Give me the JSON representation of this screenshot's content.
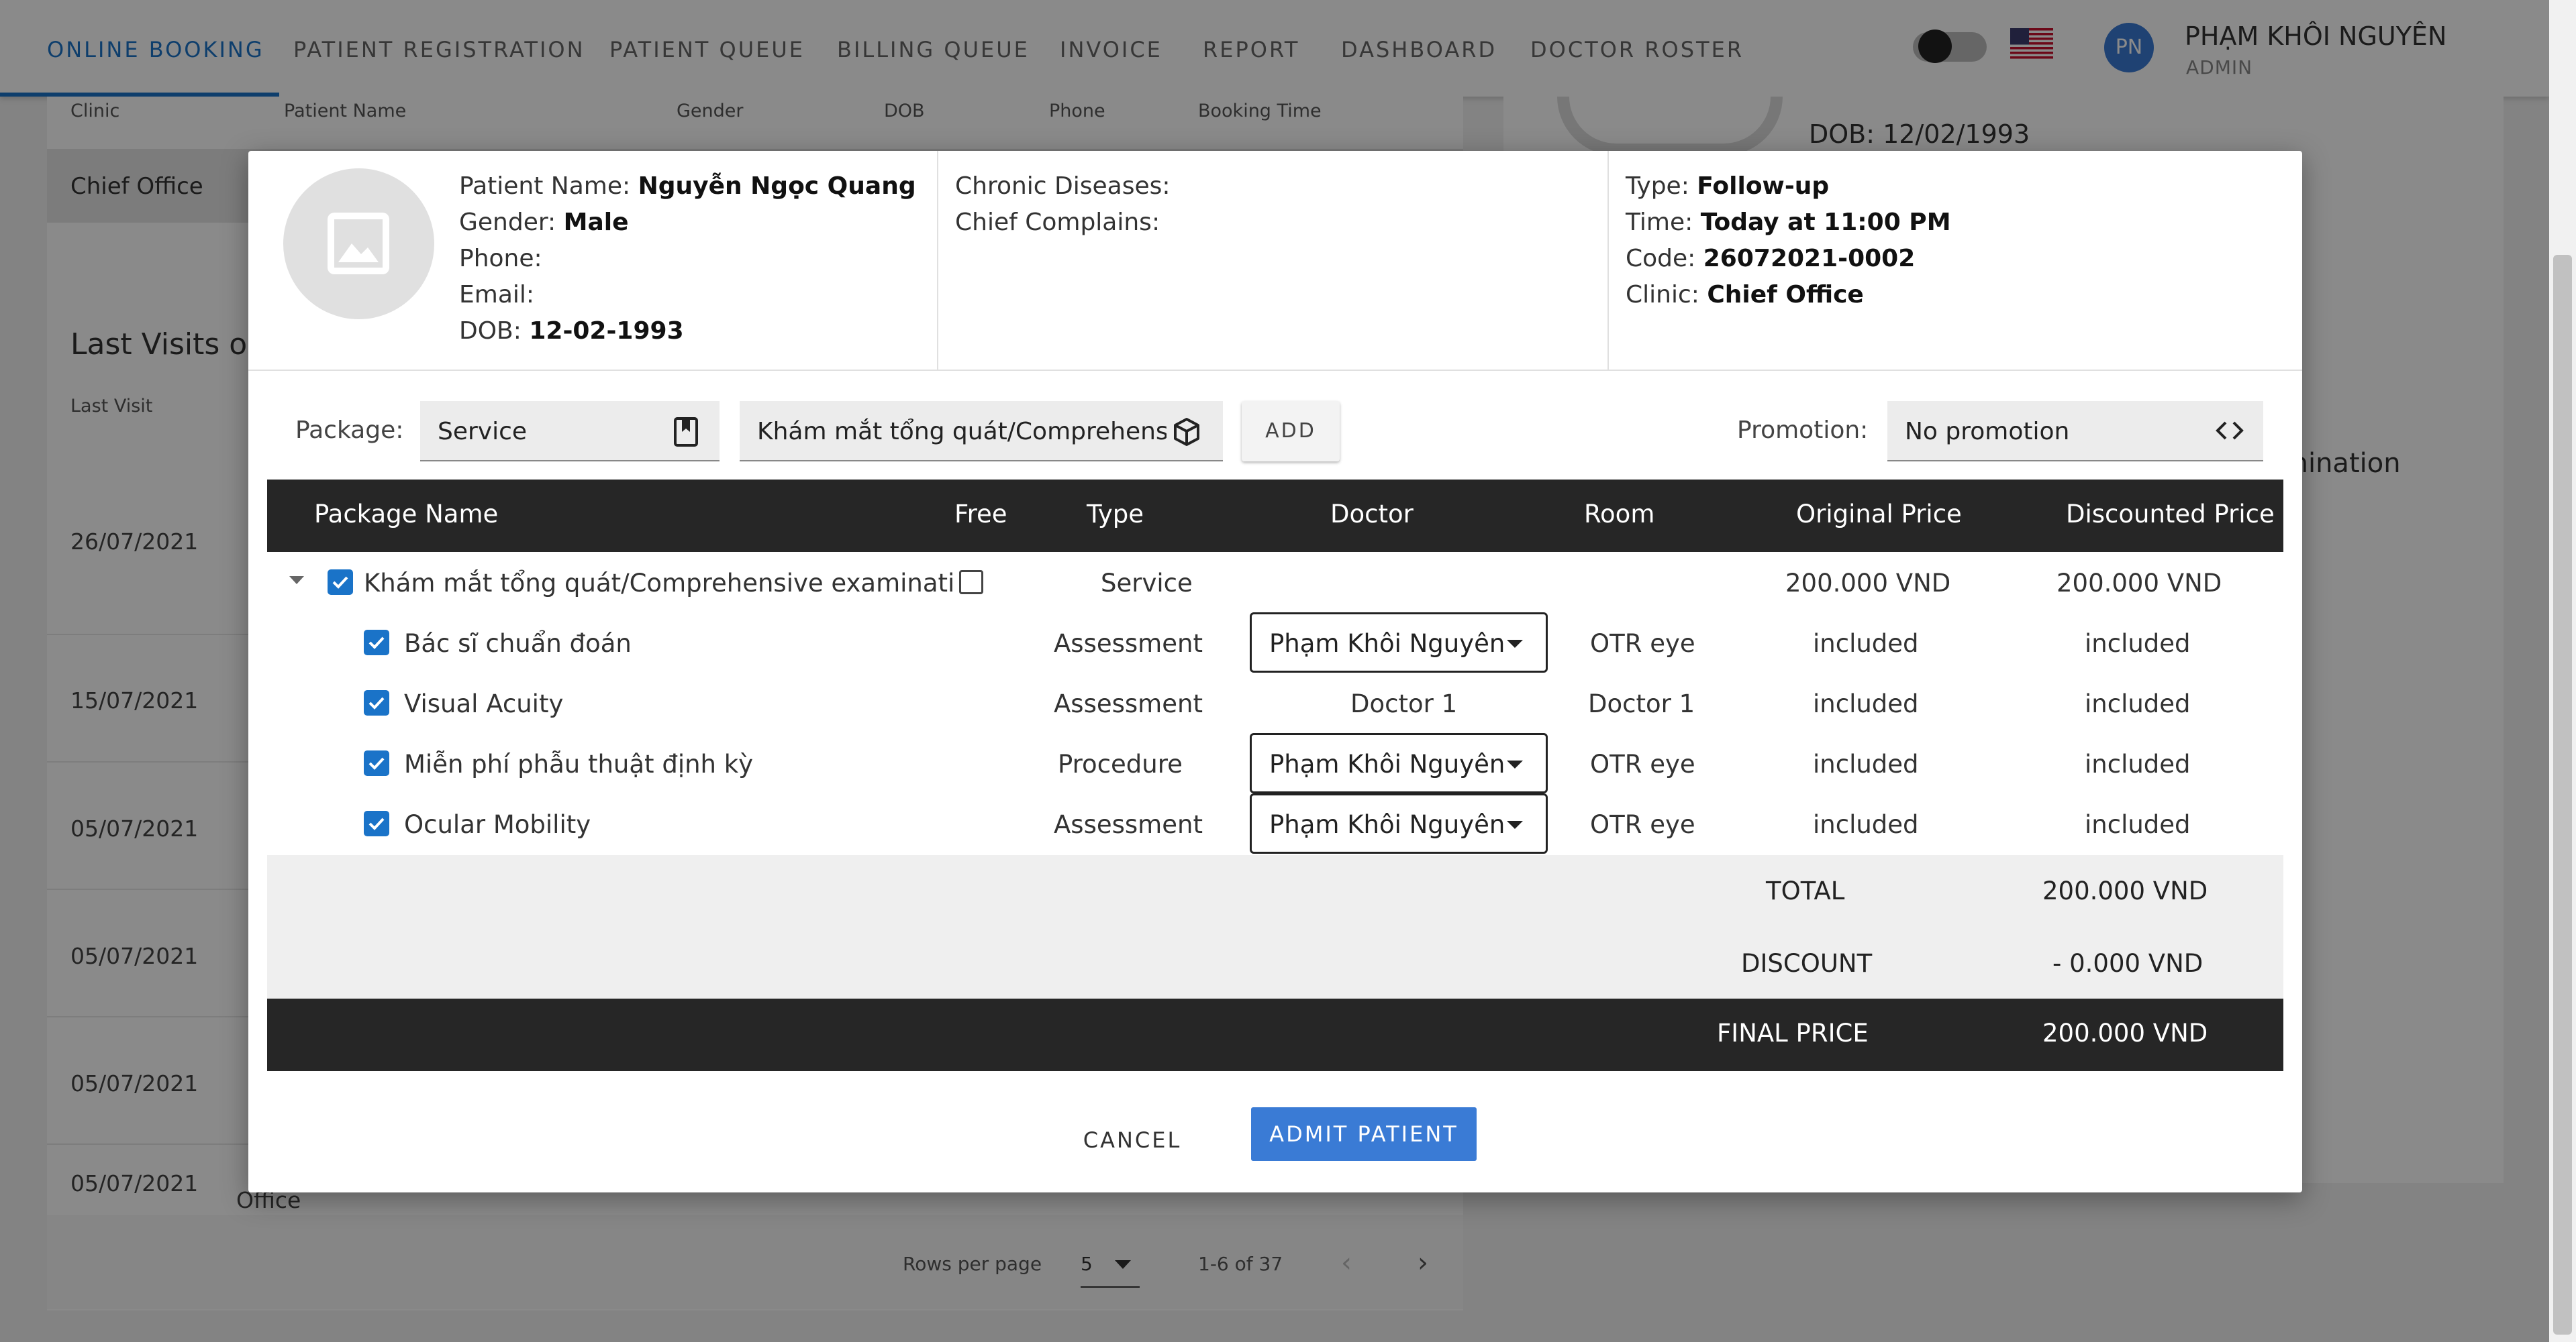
{
  "nav": {
    "tabs": [
      "ONLINE BOOKING",
      "PATIENT REGISTRATION",
      "PATIENT QUEUE",
      "BILLING QUEUE",
      "INVOICE",
      "REPORT",
      "DASHBOARD",
      "DOCTOR ROSTER"
    ],
    "active_tab": "ONLINE BOOKING",
    "user": {
      "initials": "PN",
      "name": "PHẠM KHÔI NGUYÊN",
      "role": "ADMIN"
    },
    "language_flag": "us-flag-icon"
  },
  "background_page": {
    "table_headers": [
      "Clinic",
      "Patient Name",
      "Gender",
      "DOB",
      "Phone",
      "Booking Time"
    ],
    "selected_row_clinic": "Chief Office",
    "last_visits_title": "Last Visits o",
    "last_visits_header": "Last Visit",
    "last_visit_dates": [
      "26/07/2021",
      "15/07/2021",
      "05/07/2021",
      "05/07/2021",
      "05/07/2021",
      "05/07/2021"
    ],
    "office_fragment": "Office",
    "rows_per_page_label": "Rows per page",
    "rows_per_page_value": "5",
    "range": "1-6 of 37",
    "right_panel_dob": "DOB: 12/02/1993",
    "right_panel_fragment": "mination"
  },
  "modal": {
    "patient": {
      "name_label": "Patient Name:",
      "name": "Nguyễn Ngọc Quang",
      "gender_label": "Gender:",
      "gender": "Male",
      "phone_label": "Phone:",
      "phone": "",
      "email_label": "Email:",
      "email": "",
      "dob_label": "DOB:",
      "dob": "12-02-1993"
    },
    "medical": {
      "chronic_label": "Chronic Diseases:",
      "chronic": "",
      "complains_label": "Chief Complains:",
      "complains": ""
    },
    "booking": {
      "type_label": "Type:",
      "type": "Follow-up",
      "time_label": "Time:",
      "time": "Today at 11:00 PM",
      "code_label": "Code:",
      "code": "26072021-0002",
      "clinic_label": "Clinic:",
      "clinic": "Chief Office"
    },
    "package_bar": {
      "package_label": "Package:",
      "package_type": "Service",
      "package_item": "Khám mắt tổng quát/Comprehensi",
      "add_label": "ADD",
      "promotion_label": "Promotion:",
      "promotion_value": "No promotion"
    },
    "table": {
      "headers": [
        "Package Name",
        "Free",
        "Type",
        "Doctor",
        "Room",
        "Original Price",
        "Discounted Price"
      ],
      "parent": {
        "name": "Khám mắt tổng quát/Comprehensive examinati...",
        "type": "Service",
        "original_price": "200.000 VND",
        "discounted_price": "200.000 VND"
      },
      "children": [
        {
          "name": "Bác sĩ chuẩn đoán",
          "type": "Assessment",
          "doctor": "Phạm Khôi Nguyên",
          "room": "OTR eye",
          "original": "included",
          "discounted": "included"
        },
        {
          "name": "Visual Acuity",
          "type": "Assessment",
          "doctor": "Doctor 1",
          "room": "Doctor 1",
          "original": "included",
          "discounted": "included"
        },
        {
          "name": "Miễn phí phẫu thuật định kỳ",
          "type": "Procedure",
          "doctor": "Phạm Khôi Nguyên",
          "room": "OTR eye",
          "original": "included",
          "discounted": "included"
        },
        {
          "name": "Ocular Mobility",
          "type": "Assessment",
          "doctor": "Phạm Khôi Nguyên",
          "room": "OTR eye",
          "original": "included",
          "discounted": "included"
        }
      ]
    },
    "summary": {
      "total_label": "TOTAL",
      "total": "200.000 VND",
      "discount_label": "DISCOUNT",
      "discount": "- 0.000 VND",
      "final_label": "FINAL PRICE",
      "final": "200.000 VND"
    },
    "actions": {
      "cancel": "CANCEL",
      "admit": "ADMIT PATIENT"
    }
  },
  "colors": {
    "accent": "#1a73c8",
    "admit_button": "#3a7bd5",
    "table_header": "#262626",
    "overlay": "rgba(0,0,0,0.46)"
  }
}
